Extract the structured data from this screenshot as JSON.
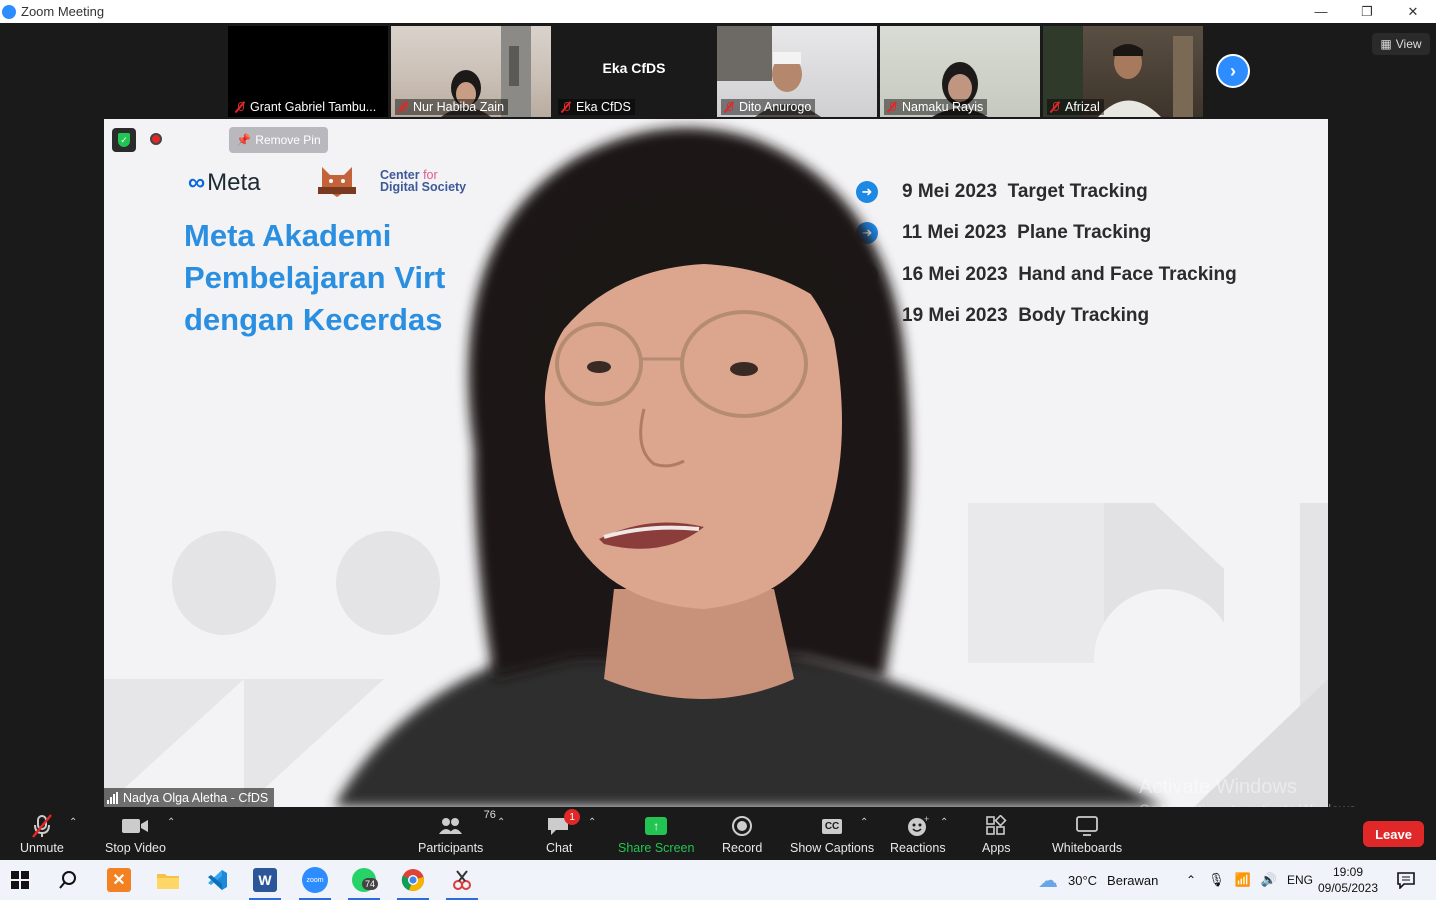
{
  "window": {
    "title": "Zoom Meeting",
    "controls": [
      "—",
      "❐",
      "✕"
    ]
  },
  "gallery": {
    "participants": [
      {
        "name": "Grant Gabriel Tambu...",
        "muted": true
      },
      {
        "name": "Nur Habiba Zain",
        "muted": true
      },
      {
        "name": "Eka CfDS",
        "display": "Eka CfDS",
        "muted": true
      },
      {
        "name": "Dito Anurogo",
        "muted": true
      },
      {
        "name": "Namaku Rayis",
        "muted": true
      },
      {
        "name": "Afrizal",
        "muted": true
      }
    ],
    "view_label": "View"
  },
  "main_video": {
    "remove_pin_label": "Remove Pin",
    "speaker_label": "Nadya Olga Aletha - CfDS",
    "slide": {
      "meta_logo_text": "Meta",
      "cfds_line1": "Center ",
      "cfds_for": "for",
      "cfds_line2": "Digital Society",
      "headline": [
        "Meta Akademi",
        "Pembelajaran Virt",
        "dengan Kecerdas"
      ],
      "schedule": [
        {
          "date": "9 Mei 2023",
          "topic": "Target Tracking"
        },
        {
          "date": "11 Mei 2023",
          "topic": "Plane Tracking"
        },
        {
          "date": "16 Mei 2023",
          "topic": "Hand and Face Tracking"
        },
        {
          "date": "19 Mei 2023",
          "topic": "Body Tracking"
        }
      ]
    }
  },
  "watermark": {
    "line1": "Activate Windows",
    "line2": "Go to Settings to activate Windows."
  },
  "toolbar": {
    "unmute": "Unmute",
    "stop_video": "Stop Video",
    "participants": "Participants",
    "participants_count": "76",
    "chat": "Chat",
    "chat_badge": "1",
    "share_screen": "Share Screen",
    "record": "Record",
    "show_captions": "Show Captions",
    "reactions": "Reactions",
    "apps": "Apps",
    "whiteboards": "Whiteboards",
    "leave": "Leave",
    "captions_icon_text": "CC"
  },
  "taskbar": {
    "whatsapp_badge": "74",
    "zoom_icon_text": "zoom",
    "word_icon_text": "W",
    "weather_temp": "30°C",
    "weather_desc": "Berawan",
    "language": "ENG",
    "time": "19:09",
    "date": "09/05/2023"
  },
  "colors": {
    "accent_blue": "#2d8cff",
    "leave_red": "#e02828",
    "share_green": "#23c552",
    "headline_blue": "#2a8fe0"
  }
}
